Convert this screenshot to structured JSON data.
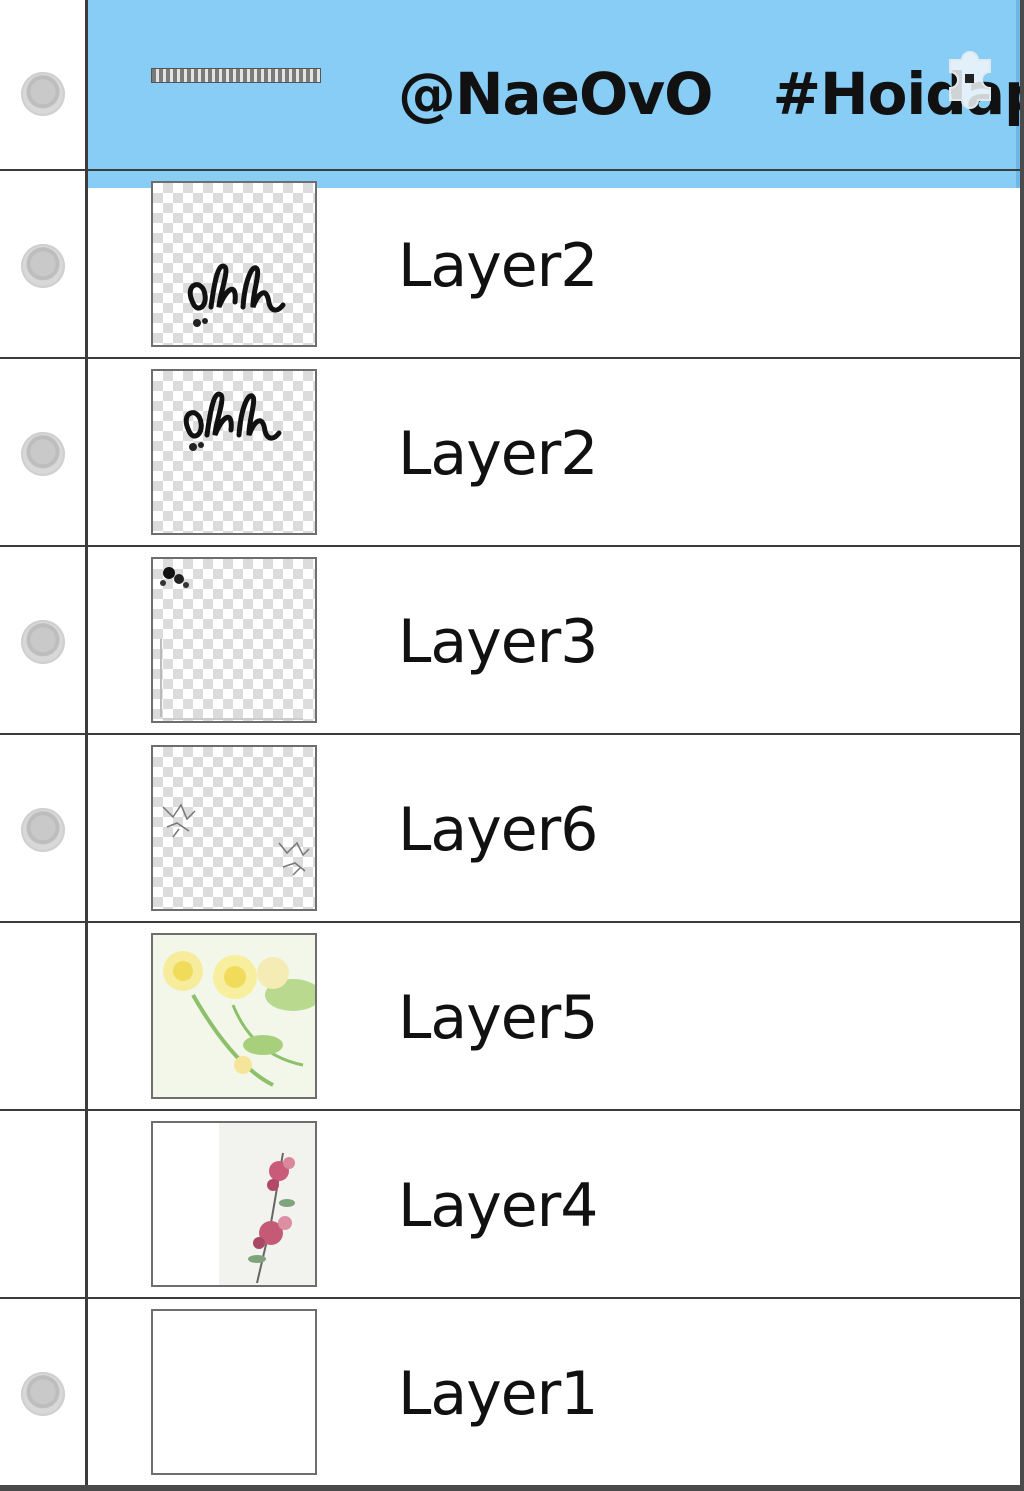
{
  "layers": [
    {
      "name_part1": "@NaeOvO",
      "name_part2": "#Hoidap",
      "selected": true,
      "visible": true,
      "thumb": "text-line"
    },
    {
      "name": "Layer2",
      "visible": true,
      "thumb": "script-lower"
    },
    {
      "name": "Layer2",
      "visible": true,
      "thumb": "script-upper"
    },
    {
      "name": "Layer3",
      "visible": true,
      "thumb": "corner-ornament"
    },
    {
      "name": "Layer6",
      "visible": true,
      "thumb": "sketch-flowers"
    },
    {
      "name": "Layer5",
      "visible": false,
      "thumb": "yellow-flowers"
    },
    {
      "name": "Layer4",
      "visible": false,
      "thumb": "pink-flowers"
    },
    {
      "name": "Layer1",
      "visible": true,
      "thumb": "blank-white"
    }
  ],
  "colors": {
    "selected_row": "#87cdf6",
    "divider": "#3c3c3c",
    "visibility_dot": "#c9c9c9"
  },
  "icons": {
    "visibility": "eye-dot-icon",
    "overlay": "puzzle-icon"
  }
}
